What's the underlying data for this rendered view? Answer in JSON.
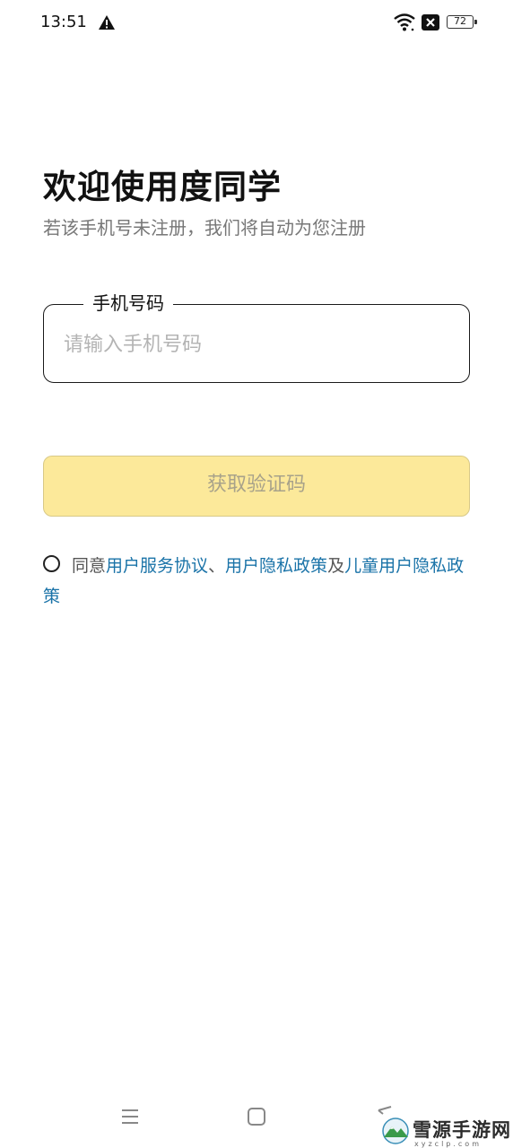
{
  "status_bar": {
    "time": "13:51",
    "battery_level": "72",
    "icons": [
      "warning-icon",
      "wifi-icon",
      "close-box-icon",
      "battery-icon"
    ]
  },
  "header": {
    "title": "欢迎使用度同学",
    "subtitle": "若该手机号未注册，我们将自动为您注册"
  },
  "phone_field": {
    "label": "手机号码",
    "placeholder": "请输入手机号码",
    "value": ""
  },
  "get_code_button": {
    "label": "获取验证码",
    "state": "disabled",
    "bg_color": "#fce99a"
  },
  "agreement": {
    "checked": false,
    "prefix": "同意",
    "link_user_agreement": "用户服务协议",
    "separator": "、",
    "link_privacy": "用户隐私政策",
    "conjunction": "及",
    "link_child_privacy": "儿童用户隐私政策",
    "link_color": "#1a73a8"
  },
  "navbar": {
    "icons": [
      "menu-icon",
      "home-icon",
      "back-icon"
    ]
  },
  "watermark": {
    "title": "雪源手游网",
    "subtitle": "xyzclp.com"
  }
}
